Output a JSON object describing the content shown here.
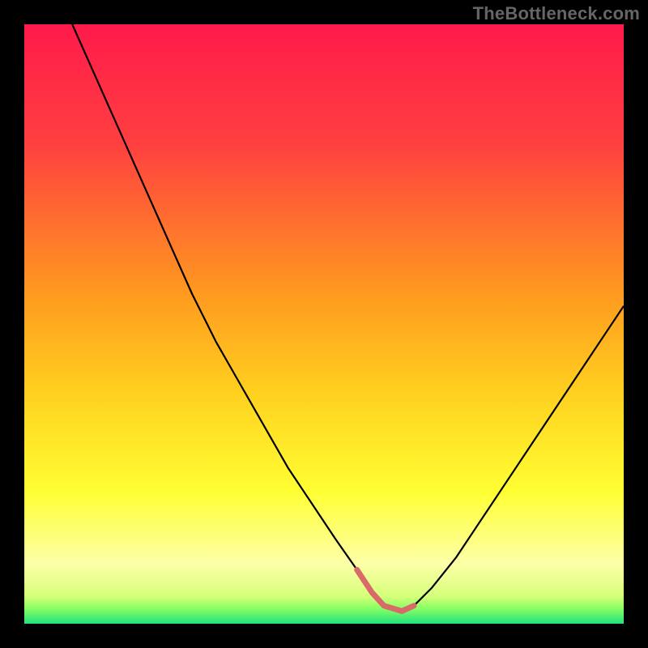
{
  "attribution": "TheBottleneck.com",
  "chart_data": {
    "type": "line",
    "title": "",
    "xlabel": "",
    "ylabel": "",
    "xlim": [
      0,
      100
    ],
    "ylim": [
      0,
      100
    ],
    "gradient_stops": [
      {
        "offset": 0,
        "color": "#ff1a4b"
      },
      {
        "offset": 20,
        "color": "#ff4040"
      },
      {
        "offset": 45,
        "color": "#ff9a1f"
      },
      {
        "offset": 62,
        "color": "#ffd21f"
      },
      {
        "offset": 78,
        "color": "#ffff33"
      },
      {
        "offset": 90,
        "color": "#fdffa8"
      },
      {
        "offset": 95.5,
        "color": "#d5ff7a"
      },
      {
        "offset": 97.5,
        "color": "#86ff64"
      },
      {
        "offset": 100,
        "color": "#20e27e"
      }
    ],
    "series": [
      {
        "name": "bottleneck-curve",
        "stroke": "#000000",
        "stroke_width": 2.2,
        "x": [
          8,
          12,
          16,
          20,
          24,
          28,
          32,
          36,
          40,
          44,
          48,
          52,
          55.5,
          58,
          60,
          63,
          65,
          68,
          72,
          76,
          80,
          84,
          88,
          92,
          96,
          100
        ],
        "y": [
          100,
          91,
          82,
          73,
          64,
          55,
          47,
          40,
          33,
          26,
          20,
          14,
          9,
          5.2,
          3,
          2.1,
          3,
          6,
          11,
          17,
          23,
          29,
          35,
          41,
          47,
          53
        ]
      },
      {
        "name": "valley-accent",
        "stroke": "#d86a6a",
        "stroke_width": 7,
        "linecap": "round",
        "x": [
          55.5,
          58,
          60,
          63,
          65
        ],
        "y": [
          9,
          5.2,
          3,
          2.1,
          3
        ]
      }
    ]
  }
}
